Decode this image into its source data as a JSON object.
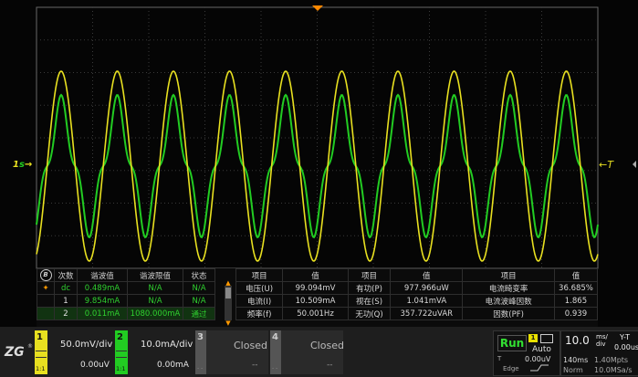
{
  "colors": {
    "ch1": "#e8e020",
    "ch2": "#22cc22",
    "grid": "#3a3a3a",
    "trigger_marker": "#ff8800"
  },
  "markers": {
    "left_ch": "1",
    "right_label": "T"
  },
  "table": {
    "header": {
      "badge": "B",
      "order": "次数",
      "value": "谐波值",
      "limit": "谐波限值",
      "status": "状态"
    },
    "rows": [
      {
        "order": "dc",
        "value": "0.489mA",
        "limit": "N/A",
        "status": "N/A"
      },
      {
        "order": "1",
        "value": "9.854mA",
        "limit": "N/A",
        "status": "N/A"
      },
      {
        "order": "2",
        "value": "0.011mA",
        "limit": "1080.000mA",
        "status": "通过"
      }
    ]
  },
  "measure": {
    "header": {
      "item1": "项目",
      "val1": "值",
      "item2": "项目",
      "val2": "值",
      "item3": "项目",
      "val3": "值"
    },
    "rows": [
      {
        "item1": "电压(U)",
        "val1": "99.094mV",
        "item2": "有功(P)",
        "val2": "977.966uW",
        "item3": "电流畸变率",
        "val3": "36.685%"
      },
      {
        "item1": "电流(I)",
        "val1": "10.509mA",
        "item2": "视在(S)",
        "val2": "1.041mVA",
        "item3": "电流波峰因数",
        "val3": "1.865"
      },
      {
        "item1": "频率(f)",
        "val1": "50.001Hz",
        "item2": "无功(Q)",
        "val2": "357.722uVAR",
        "item3": "因数(PF)",
        "val3": "0.939"
      }
    ]
  },
  "bottom": {
    "logo": "ZG",
    "ch1": {
      "num": "1",
      "scale": "50.0mV/div",
      "offset": "0.00uV",
      "ratio": "1:1"
    },
    "ch2": {
      "num": "2",
      "scale": "10.0mA/div",
      "offset": "0.00mA",
      "ratio": "1:1"
    },
    "ch3": {
      "num": "3",
      "label": "Closed",
      "dash": "--",
      "ratio": "- -"
    },
    "ch4": {
      "num": "4",
      "label": "Closed",
      "dash": "--",
      "ratio": "- -"
    },
    "trigger": {
      "run": "Run",
      "source": "1",
      "mode": "Auto",
      "t": "T",
      "level": "0.00uV",
      "edge": "Edge"
    },
    "timebase": {
      "scale": "10.0",
      "unit_top": "ms/",
      "unit_bot": "div",
      "mode": "Y-T",
      "delay": "0.00us",
      "mem": "140ms",
      "rate": "1.40Mpts",
      "norm": "Norm",
      "srate": "10.0MSa/s"
    }
  }
}
